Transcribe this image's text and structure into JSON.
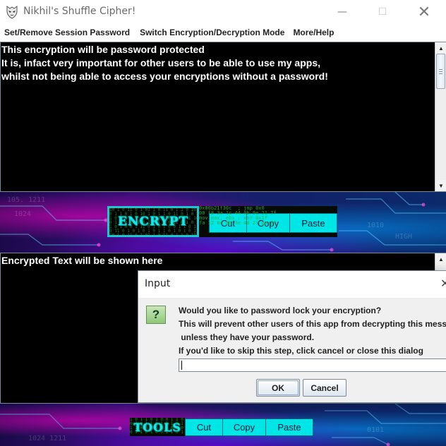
{
  "window": {
    "title": "Nikhil's Shuffle Cipher!",
    "minimize_glyph": "—",
    "maximize_glyph": "☐",
    "close_glyph": "✕"
  },
  "menu": {
    "items": [
      {
        "label": "Set/Remove Session Password"
      },
      {
        "label": "Switch Encryption/Decryption Mode"
      },
      {
        "label": "More/Help"
      }
    ]
  },
  "input_area": {
    "lines": [
      "This encryption will be password protected",
      "It is, infact very important for other users to be able to use my apps,",
      "whilst not being able to access your encryptions without a password!"
    ]
  },
  "encrypt_panel": {
    "logo_text": "ENCRYPT",
    "buttons": {
      "cut": "Cut",
      "copy": "Copy",
      "paste": "Paste"
    }
  },
  "output_area": {
    "text": "Encrypted Text will be shown here"
  },
  "tools_panel": {
    "logo_text": "TOOLS",
    "buttons": {
      "cut": "Cut",
      "copy": "Copy",
      "paste": "Paste"
    }
  },
  "dialog": {
    "title": "Input",
    "close_glyph": "✕",
    "icon_glyph": "?",
    "messages": [
      "Would you like to password lock your encryption?",
      "This will prevent other users of this app from decrypting this message",
      " unless they have your password.",
      "If you'd like to skip this step, click cancel or close this dialog"
    ],
    "input_value": "",
    "ok_label": "OK",
    "cancel_label": "Cancel"
  },
  "colors": {
    "textarea_bg": "#000000",
    "textarea_fg": "#ffffff",
    "tool_button": "#00e5e5",
    "logo_border": "#19c7d4",
    "question_icon": "#8ec878"
  },
  "icons": {
    "app": "mask-icon",
    "question": "question-icon"
  }
}
